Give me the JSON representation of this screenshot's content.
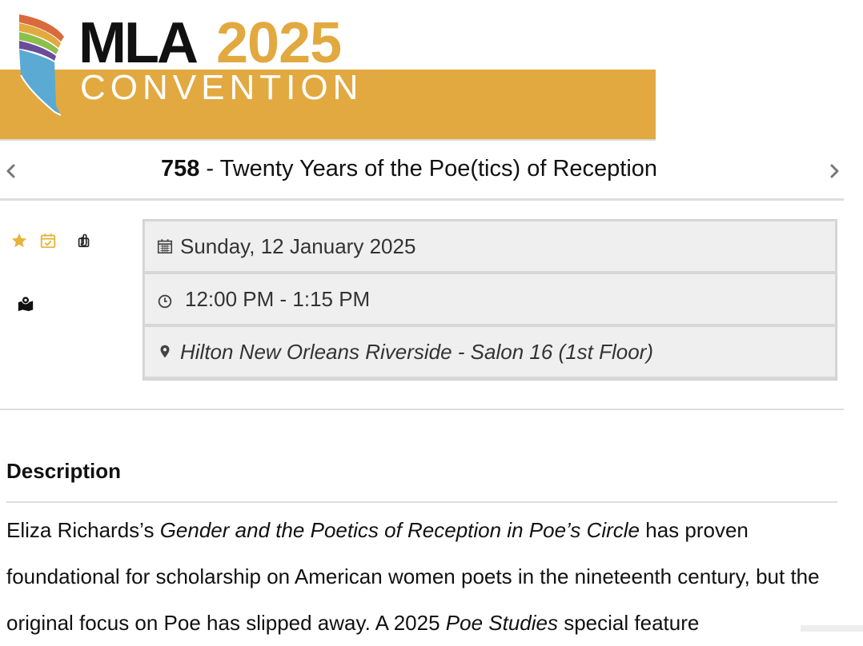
{
  "banner": {
    "logo_mla": "MLA",
    "logo_year": "2025",
    "logo_convention": "CONVENTION",
    "colors": {
      "gold": "#e2a940",
      "dark": "#111111",
      "white": "#ffffff"
    }
  },
  "session": {
    "number": "758",
    "separator": " - ",
    "title": "Twenty Years of the Poe(tics) of Reception",
    "prev_icon": "chevron-left-icon",
    "next_icon": "chevron-right-icon"
  },
  "actions": {
    "favorite_icon": "star-icon",
    "schedule_icon": "calendar-check-icon",
    "attachment_icon": "paperclip-icon",
    "map_icon": "map-marker-icon",
    "colors": {
      "accent": "#e6b43a"
    }
  },
  "details": {
    "date": "Sunday, 12 January 2025",
    "time": "12:00 PM - 1:15 PM",
    "location": "Hilton New Orleans Riverside - Salon 16 (1st Floor)",
    "date_icon": "calendar-icon",
    "time_icon": "clock-icon",
    "location_icon": "location-pin-icon"
  },
  "description": {
    "heading": "Description",
    "p1": "Eliza Richards’s ",
    "book_title": "Gender and the Poetics of Reception in Poe’s Circle",
    "p2": " has proven foundational for scholarship on American women poets in the nineteenth century, but the original focus on Poe has slipped away. A 2025 ",
    "journal_title": "Poe Studies",
    "p3": " special feature"
  }
}
